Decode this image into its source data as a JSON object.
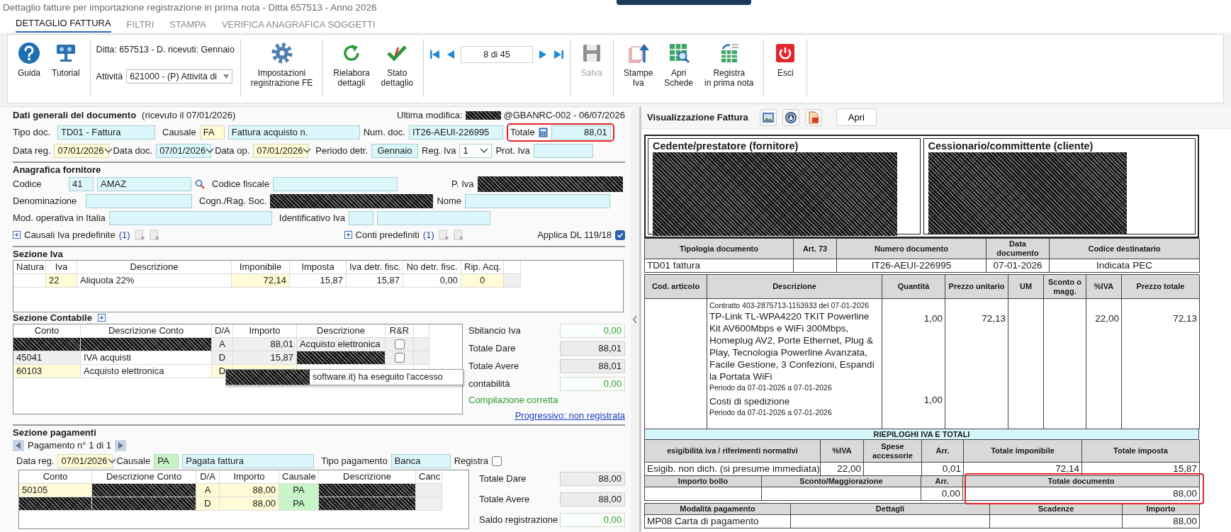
{
  "window": {
    "title": "Dettaglio fatture per importazione registrazione in prima nota - Ditta 657513 - Anno 2026"
  },
  "tabs": [
    {
      "label": "DETTAGLIO FATTURA",
      "selected": true
    },
    {
      "label": "FILTRI",
      "selected": false
    },
    {
      "label": "STAMPA",
      "selected": false
    },
    {
      "label": "VERIFICA ANAGRAFICA SOGGETTI",
      "selected": false
    }
  ],
  "toolbar": {
    "groups": [
      [
        {
          "kind": "help",
          "label": "Guida",
          "disabled": false
        },
        {
          "kind": "tutorial",
          "label": "Tutorial",
          "disabled": false
        }
      ],
      [
        {
          "kind": "company",
          "text": "Ditta: 657513 - D. ricevuti: Gennaio",
          "activity_label": "Attività",
          "activity_value": "621000 - (P) Attività di"
        }
      ],
      [
        {
          "kind": "settings",
          "label": "Impostazioni\nregistrazione FE",
          "disabled": false
        }
      ],
      [
        {
          "kind": "refresh",
          "label": "Rielabora\ndettagli",
          "disabled": false
        },
        {
          "kind": "status",
          "label": "Stato\ndettaglio",
          "disabled": false
        }
      ],
      [
        {
          "kind": "navigator",
          "position": "8 di 45"
        }
      ],
      [
        {
          "kind": "save",
          "label": "Salva",
          "disabled": true
        }
      ],
      [
        {
          "kind": "print",
          "label": "Stampe\nIva",
          "disabled": false
        },
        {
          "kind": "sheets",
          "label": "Apri\nSchede",
          "disabled": false
        },
        {
          "kind": "register",
          "label": "Registra\nin prima nota",
          "disabled": false
        }
      ],
      [
        {
          "kind": "exit",
          "label": "Esci",
          "disabled": false
        }
      ]
    ]
  },
  "general": {
    "title": "Dati generali del documento",
    "received": "(ricevuto il 07/01/2026)",
    "last_modified_label": "Ultima modifica:",
    "last_modified_tail": "@GBANRC-002 - 06/07/2026",
    "doc_type": {
      "label": "Tipo doc.",
      "value": "TD01 - Fattura"
    },
    "reason": {
      "label": "Causale",
      "code": "FA",
      "value": "Fattura acquisto n."
    },
    "doc_number": {
      "label": "Num. doc.",
      "value": "IT26-AEUI-226995"
    },
    "total": {
      "label": "Totale",
      "value": "88,01"
    },
    "reg_date": {
      "label": "Data reg.",
      "value": "07/01/2026"
    },
    "doc_date": {
      "label": "Data doc.",
      "value": "07/01/2026"
    },
    "op_date": {
      "label": "Data op.",
      "value": "07/01/2026"
    },
    "period": {
      "label": "Periodo detr.",
      "value": "Gennaio"
    },
    "vat_register": {
      "label": "Reg. Iva",
      "value": "1"
    },
    "protocol": {
      "label": "Prot. Iva"
    }
  },
  "supplier": {
    "title": "Anagrafica fornitore",
    "code": {
      "label": "Codice",
      "number": "41",
      "value": "AMAZ"
    },
    "tax_code": {
      "label": "Codice fiscale"
    },
    "vat_number": {
      "label": "P. Iva"
    },
    "name": {
      "label": "Denominazione"
    },
    "surname": {
      "label": "Cogn./Rag. Soc."
    },
    "first_name": {
      "label": "Nome"
    },
    "operating": {
      "label": "Mod. operativa in Italia"
    },
    "vat_id": {
      "label": "Identificativo Iva"
    },
    "vat_reasons": {
      "label": "Causali Iva predefinite",
      "count": "(1)"
    },
    "accounts": {
      "label": "Conti predefiniti",
      "count": "(1)"
    },
    "dl": {
      "label": "Applica DL 119/18",
      "checked": true
    }
  },
  "vat_section": {
    "title": "Sezione Iva",
    "columns": [
      "Natura",
      "Iva",
      "Descrizione",
      "Imponibile",
      "Imposta",
      "Iva detr. fisc.",
      "No detr. fisc.",
      "Rip. Acq."
    ],
    "rows": [
      {
        "rate": "22",
        "description": "Aliquota 22%",
        "taxable": "72,14",
        "tax": "15,87",
        "deductible": "15,87",
        "non_deductible": "0,00",
        "rip_acq": "0"
      }
    ]
  },
  "accounting_section": {
    "title": "Sezione Contabile",
    "columns": [
      "Conto",
      "Descrizione Conto",
      "D/A",
      "Importo",
      "Descrizione",
      "R&R"
    ],
    "rows": [
      {
        "selected": false,
        "account": {
          "redacted": true
        },
        "account_description": {
          "redacted": true
        },
        "side": "A",
        "amount": "88,01",
        "description": "Acquisto elettronica",
        "rr_checked": false
      },
      {
        "selected": false,
        "account": "45041",
        "account_description": "IVA acquisti",
        "side": "D",
        "amount": "15,87",
        "description": {
          "redacted": true
        },
        "rr_checked": false
      },
      {
        "selected": true,
        "account": "60103",
        "account_description": "Acquisto elettronica",
        "side": "D"
      }
    ],
    "tooltip": "software.it) ha eseguito l'accesso",
    "summary": [
      {
        "label": "Sbilancio Iva",
        "value": "0,00",
        "kind": "ok"
      },
      {
        "label": "Totale Dare",
        "value": "88,01",
        "kind": "total"
      },
      {
        "label": "Totale Avere",
        "value": "88,01",
        "kind": "total"
      },
      {
        "label": "contabilità",
        "value": "0,00",
        "kind": "ok"
      }
    ],
    "status": "Compilazione corretta",
    "link": "Progressivo: non registrata"
  },
  "payments_section": {
    "title": "Sezione pagamenti",
    "pager": "Pagamento n° 1 di 1",
    "reg_date": {
      "label": "Data reg.",
      "value": "07/01/2026"
    },
    "reason": {
      "label": "Causale",
      "code": "PA",
      "value": "Pagata fattura"
    },
    "payment_type": {
      "label": "Tipo pagamento",
      "value": "Banca"
    },
    "register": {
      "label": "Registra",
      "checked": false
    },
    "columns": [
      "Conto",
      "Descrizione Conto",
      "D/A",
      "Importo",
      "Causale",
      "Descrizione",
      "Canc"
    ],
    "rows": [
      {
        "account": "50105",
        "account_description": {
          "redacted": true
        },
        "side": "A",
        "amount": "88,00",
        "reason": "PA",
        "description": {
          "redacted": true
        }
      },
      {
        "account": {
          "redacted": true
        },
        "account_description": {
          "redacted": true
        },
        "side": "D",
        "amount": "88,00",
        "reason": "PA",
        "description": {
          "redacted": true
        }
      }
    ],
    "summary": [
      {
        "label": "Totale Dare",
        "value": "88,00",
        "kind": "total"
      },
      {
        "label": "Totale Avere",
        "value": "88,00",
        "kind": "total"
      },
      {
        "label": "Saldo registrazione",
        "value": "0,00",
        "kind": "ok"
      }
    ]
  },
  "invoice_view": {
    "title": "Visualizzazione Fattura",
    "open_button": "Apri",
    "supplier_title": "Cedente/prestatore (fornitore)",
    "customer_title": "Cessionario/committente (cliente)",
    "doc_columns": [
      "Tipologia documento",
      "Art. 73",
      "Numero documento",
      "Data documento",
      "Codice destinatario"
    ],
    "doc_values": {
      "type": "TD01 fattura",
      "number": "IT26-AEUI-226995",
      "date": "07-01-2026",
      "recipient_code": "Indicata PEC"
    },
    "line_columns": [
      "Cod. articolo",
      "Descrizione",
      "Quantità",
      "Prezzo unitario",
      "UM",
      "Sconto o magg.",
      "%IVA",
      "Prezzo totale"
    ],
    "lines": [
      {
        "pre_note": "Contratto 403-2875713-1153933 del 07-01-2026",
        "description": "TP-Link TL-WPA4220 TKIT Powerline Kit AV600Mbps e WiFi 300Mbps, Homeplug AV2, Porte Ethernet, Plug & Play, Tecnologia Powerline Avanzata, Facile Gestione, 3 Confezioni, Espandi la Portata WiFi",
        "note": "Periodo da 07-01-2026 a 07-01-2026",
        "quantity": "1,00",
        "unit_price": "72,13",
        "vat": "22,00",
        "total": "72,13"
      },
      {
        "description": "Costi di spedizione",
        "note": "Periodo da 07-01-2026 a 07-01-2026",
        "quantity": "1,00"
      }
    ],
    "summary_title": "RIEPILOGHI IVA E TOTALI",
    "vat_columns": [
      "esigibilità iva / riferimenti normativi",
      "%IVA",
      "Spese accessorie",
      "Arr.",
      "Totale imponibile",
      "Totale imposta"
    ],
    "vat_rows": [
      {
        "chargeability": "Esigib. non dich. (si presume immediata)",
        "rate": "22,00",
        "rounding": "0,01",
        "taxable_total": "72,14",
        "tax_total": "15,87"
      }
    ],
    "totals_columns": [
      "Importo bollo",
      "Sconto/Maggiorazione",
      "Arr.",
      "Totale documento"
    ],
    "totals_rows": [
      {
        "rounding": "0,00",
        "document_total": "88,00"
      }
    ],
    "payment_columns": [
      "Modalità pagamento",
      "Dettagli",
      "Scadenze",
      "Importo"
    ],
    "payment_rows": [
      {
        "method": "MP08 Carta di pagamento",
        "amount": "88,00"
      }
    ]
  }
}
